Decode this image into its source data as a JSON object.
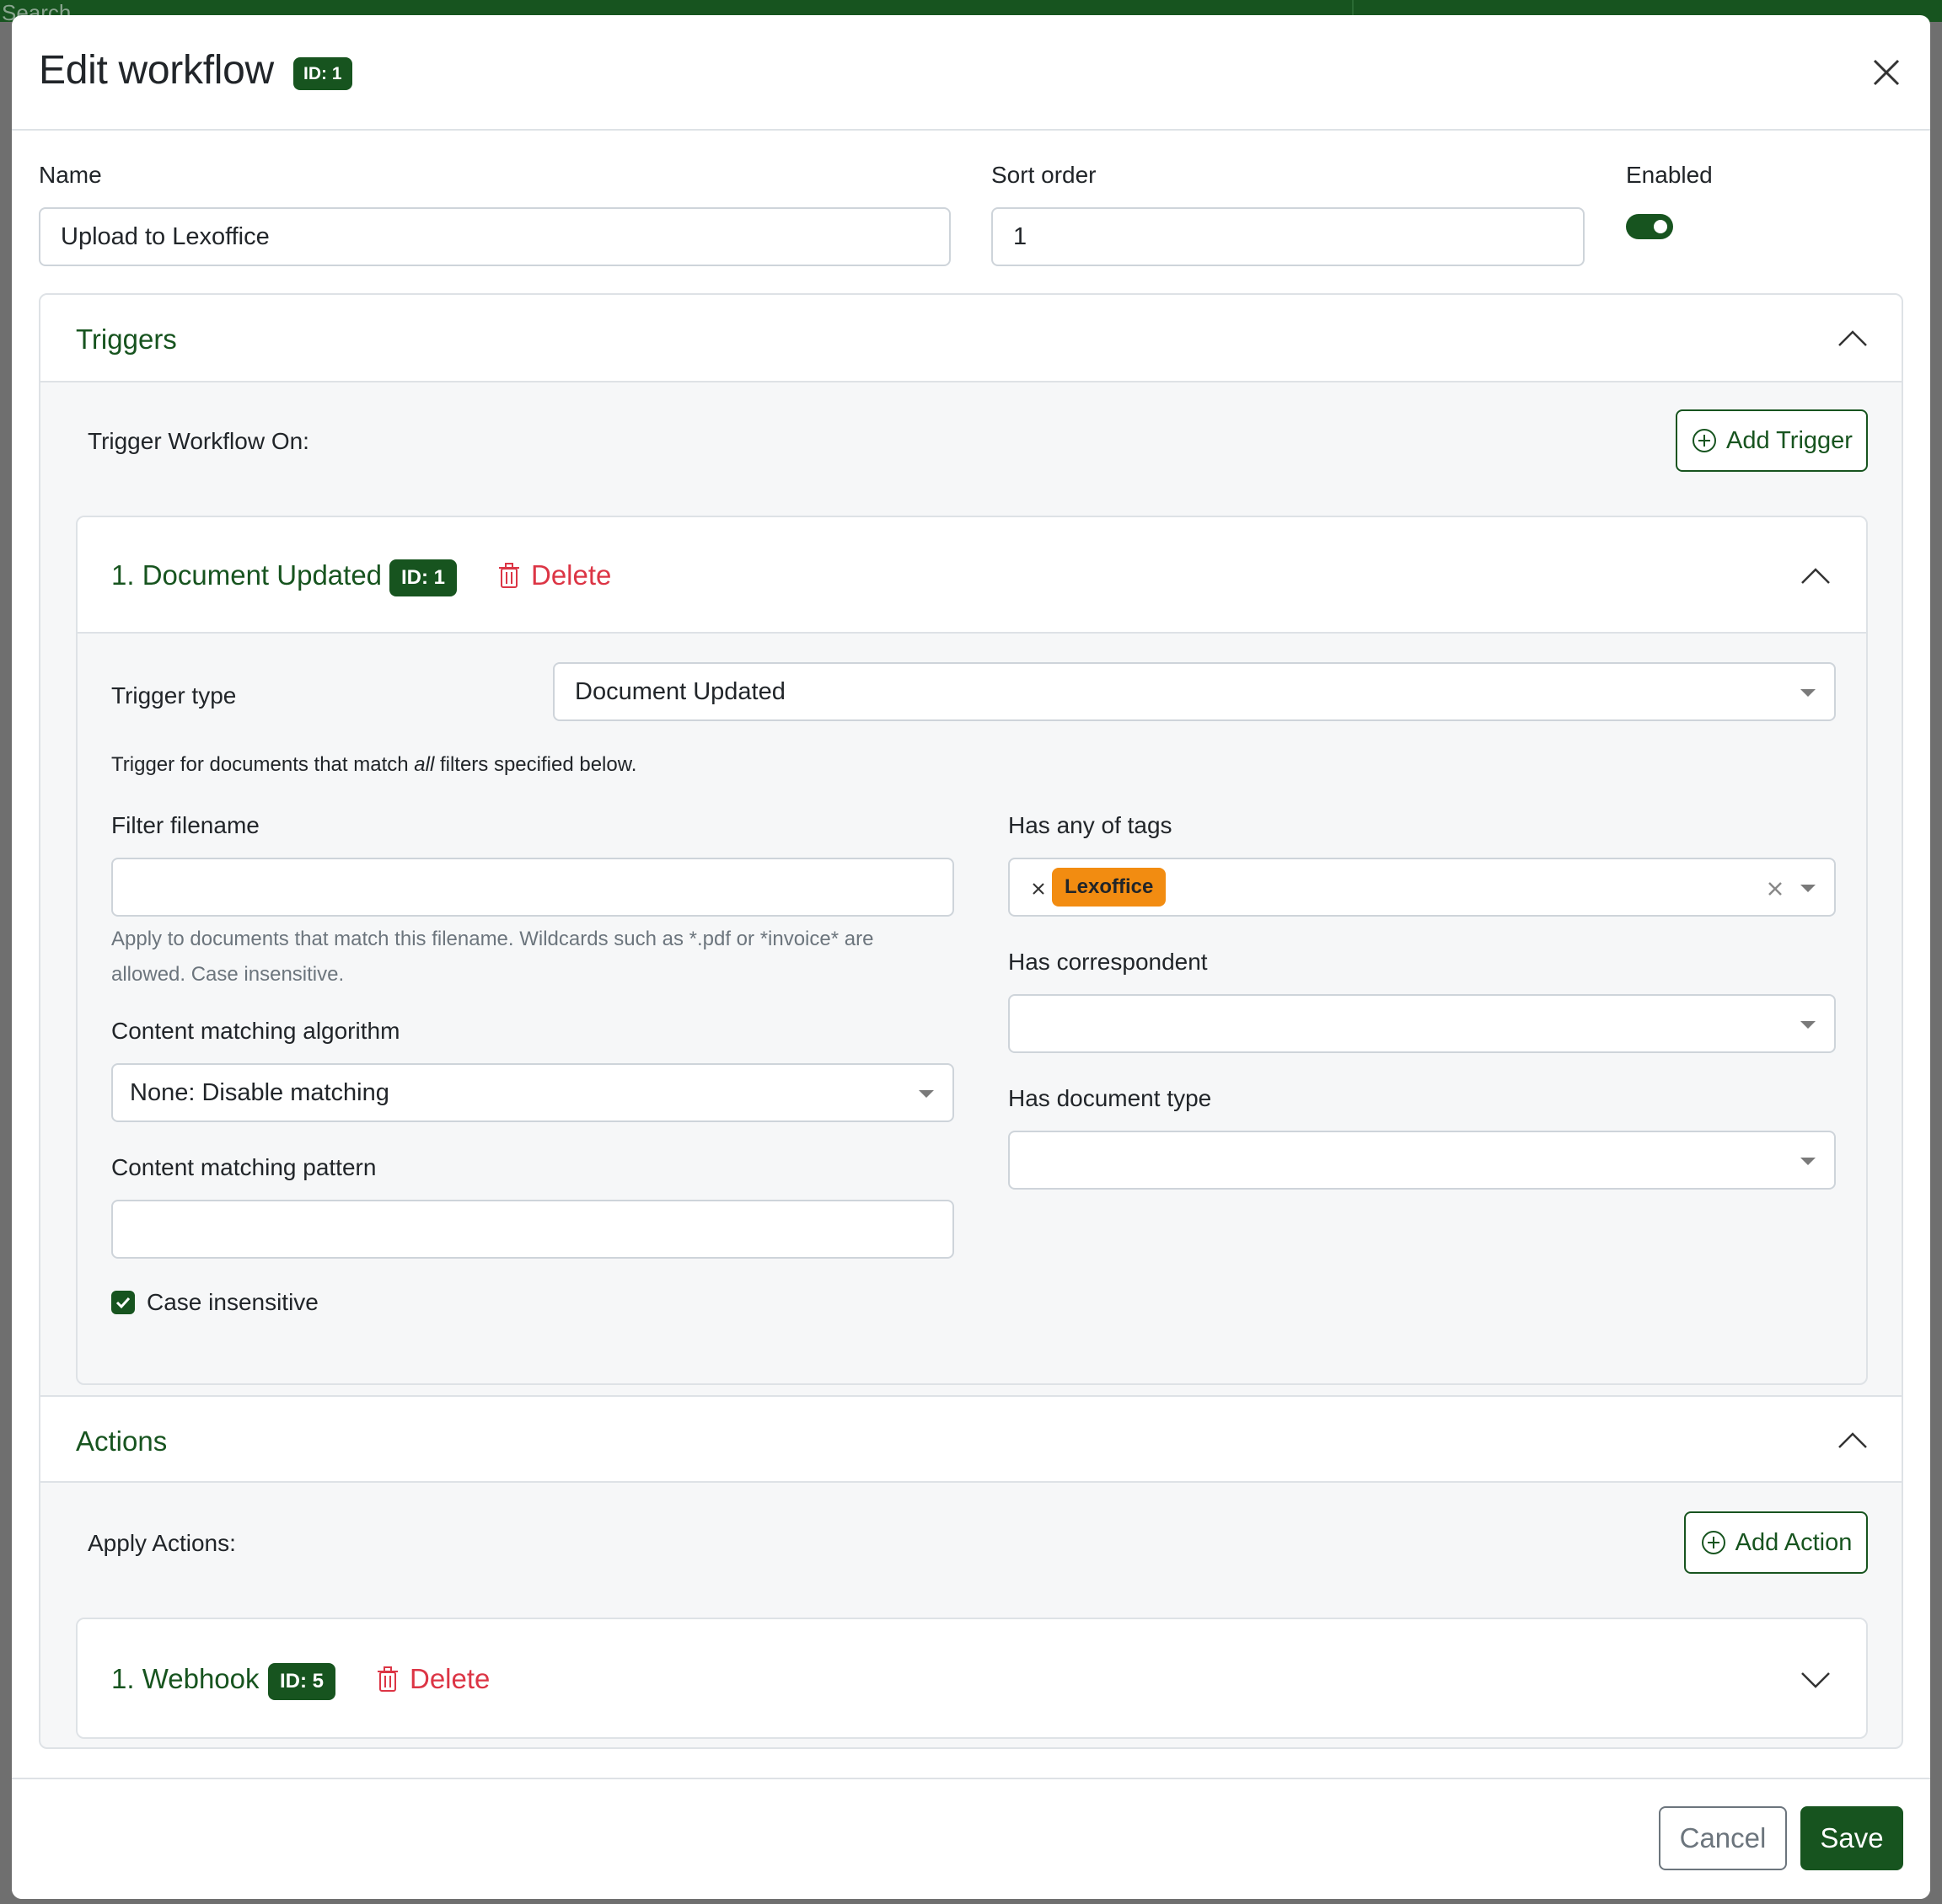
{
  "background": {
    "search_text": "Search"
  },
  "modal": {
    "title": "Edit workflow",
    "id_badge": "ID: 1"
  },
  "form": {
    "name_label": "Name",
    "name_value": "Upload to Lexoffice",
    "sort_label": "Sort order",
    "sort_value": "1",
    "enabled_label": "Enabled",
    "enabled": true
  },
  "triggers": {
    "section_title": "Triggers",
    "trigger_on_label": "Trigger Workflow On:",
    "add_button": "Add Trigger",
    "item": {
      "title": "1. Document Updated",
      "id_badge": "ID: 1",
      "delete_label": "Delete",
      "trigger_type_label": "Trigger type",
      "trigger_type_value": "Document Updated",
      "note_before": "Trigger for documents that match ",
      "note_em": "all",
      "note_after": " filters specified below.",
      "filter_filename_label": "Filter filename",
      "filter_filename_value": "",
      "filter_filename_help_1": "Apply to documents that match this filename. Wildcards such as *.pdf or *invoice* are",
      "filter_filename_help_2": "allowed. Case insensitive.",
      "content_algo_label": "Content matching algorithm",
      "content_algo_value": "None: Disable matching",
      "content_pattern_label": "Content matching pattern",
      "content_pattern_value": "",
      "case_insensitive_label": "Case insensitive",
      "case_insensitive": true,
      "tags_label": "Has any of tags",
      "tags": [
        "Lexoffice"
      ],
      "correspondent_label": "Has correspondent",
      "correspondent_value": "",
      "doctype_label": "Has document type",
      "doctype_value": ""
    }
  },
  "actions": {
    "section_title": "Actions",
    "apply_label": "Apply Actions:",
    "add_button": "Add Action",
    "item": {
      "title": "1. Webhook",
      "id_badge": "ID: 5",
      "delete_label": "Delete"
    }
  },
  "footer": {
    "cancel_label": "Cancel",
    "save_label": "Save"
  },
  "colors": {
    "primary": "#17541f",
    "danger": "#dc3545",
    "tag": "#f28c11"
  },
  "icons": [
    "close-icon",
    "chevron-up-icon",
    "chevron-down-icon",
    "plus-circle-icon",
    "trash-icon",
    "check-icon",
    "clear-icon",
    "caret-down-icon"
  ]
}
